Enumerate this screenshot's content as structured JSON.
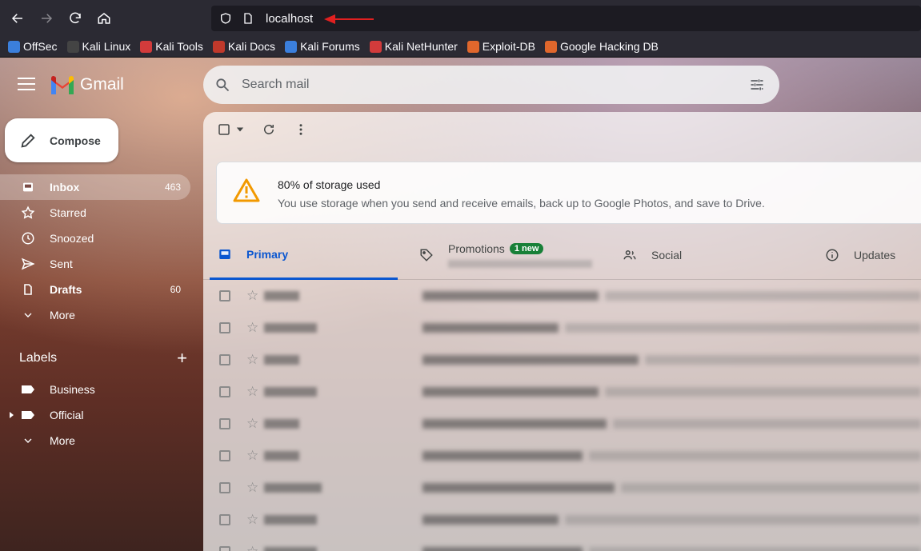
{
  "browser": {
    "url": "localhost",
    "bookmarks": [
      {
        "label": "OffSec",
        "color": "#3b7fdc"
      },
      {
        "label": "Kali Linux",
        "color": "#444444"
      },
      {
        "label": "Kali Tools",
        "color": "#d23b3b"
      },
      {
        "label": "Kali Docs",
        "color": "#c0392b"
      },
      {
        "label": "Kali Forums",
        "color": "#3b7fdc"
      },
      {
        "label": "Kali NetHunter",
        "color": "#d23b3b"
      },
      {
        "label": "Exploit-DB",
        "color": "#e0672c"
      },
      {
        "label": "Google Hacking DB",
        "color": "#e0672c"
      }
    ]
  },
  "gmail": {
    "logo_text": "Gmail",
    "search_placeholder": "Search mail",
    "compose_label": "Compose",
    "nav": [
      {
        "label": "Inbox",
        "count": "463",
        "icon": "inbox-icon"
      },
      {
        "label": "Starred",
        "count": "",
        "icon": "star-icon"
      },
      {
        "label": "Snoozed",
        "count": "",
        "icon": "clock-icon"
      },
      {
        "label": "Sent",
        "count": "",
        "icon": "send-icon"
      },
      {
        "label": "Drafts",
        "count": "60",
        "icon": "draft-icon"
      },
      {
        "label": "More",
        "count": "",
        "icon": "chevron-down-icon"
      }
    ],
    "labels_title": "Labels",
    "labels": [
      {
        "label": "Business"
      },
      {
        "label": "Official"
      },
      {
        "label": "More"
      }
    ],
    "storage": {
      "title": "80% of storage used",
      "body": "You use storage when you send and receive emails, back up to Google Photos, and save to Drive."
    },
    "tabs": {
      "primary": "Primary",
      "promotions": "Promotions",
      "promotions_badge": "1 new",
      "social": "Social",
      "updates": "Updates"
    },
    "accent_color": "#0b57d0"
  }
}
